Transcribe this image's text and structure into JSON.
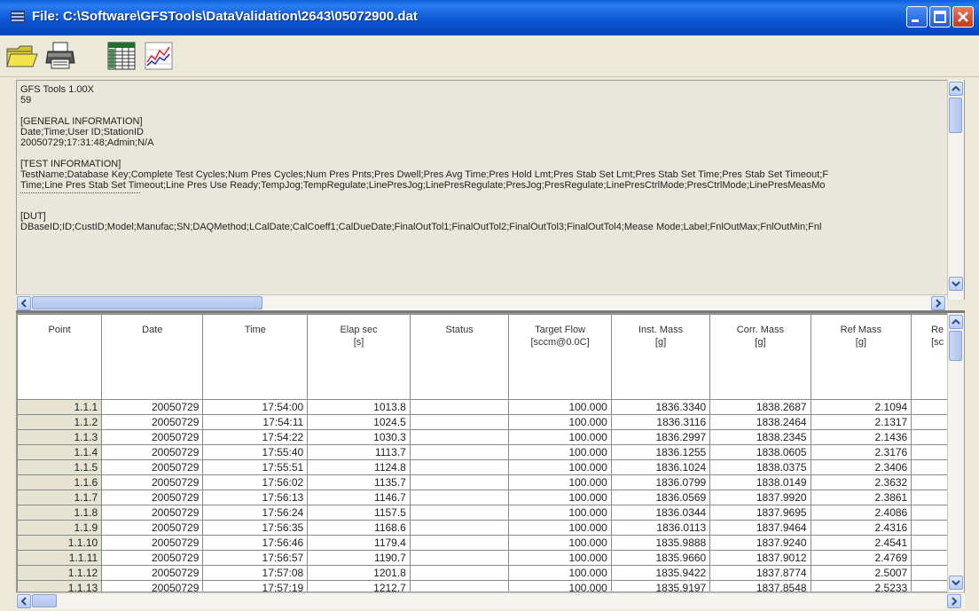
{
  "window": {
    "title": "File: C:\\Software\\GFSTools\\DataValidation\\2643\\05072900.dat"
  },
  "toolbar": {
    "icons": [
      "open-folder-icon",
      "print-icon",
      "table-icon",
      "chart-icon"
    ]
  },
  "info": {
    "line1": "GFS Tools 1.00X",
    "line2": "59",
    "general_header": "[GENERAL INFORMATION]",
    "general_fields": "Date;Time;User ID;StationID",
    "general_values": "20050729;17:31:48;Admin;N/A",
    "test_header": "[TEST INFORMATION]",
    "test_fields_1": "TestName;Database Key;Complete Test Cycles;Num Pres Cycles;Num Pres Pnts;Pres Dwell;Pres Avg Time;Pres Hold Lmt;Pres Stab Set Lmt;Pres Stab Set Time;Pres Stab Set Timeout;F",
    "test_fields_2": "Time;Line Pres Stab Set Timeout;Line Pres Use Ready;TempJog;TempRegulate;LinePresJog;LinePresRegulate;PresJog;PresRegulate;LinePresCtrlMode;PresCtrlMode;LinePresMeasMo",
    "dut_header": "[DUT]",
    "dut_fields": "DBaseID;ID;CustID;Model;Manufac;SN;DAQMethod;LCalDate;CalCoeff1;CalDueDate;FinalOutTol1;FinalOutTol2;FinalOutTol3;FinalOutTol4;Mease Mode;Label;FnlOutMax;FnlOutMin;Fnl"
  },
  "table": {
    "headers": [
      {
        "l1": "Point",
        "l2": ""
      },
      {
        "l1": "Date",
        "l2": ""
      },
      {
        "l1": "Time",
        "l2": ""
      },
      {
        "l1": "Elap sec",
        "l2": "[s]"
      },
      {
        "l1": "Status",
        "l2": ""
      },
      {
        "l1": "Target Flow",
        "l2": "[sccm@0.0C]"
      },
      {
        "l1": "Inst. Mass",
        "l2": "[g]"
      },
      {
        "l1": "Corr. Mass",
        "l2": "[g]"
      },
      {
        "l1": "Ref Mass",
        "l2": "[g]"
      },
      {
        "l1": "Re",
        "l2": "[sc"
      }
    ],
    "rows": [
      [
        "1.1.1",
        "20050729",
        "17:54:00",
        "1013.8",
        "",
        "100.000",
        "1836.3340",
        "1838.2687",
        "2.1094"
      ],
      [
        "1.1.2",
        "20050729",
        "17:54:11",
        "1024.5",
        "",
        "100.000",
        "1836.3116",
        "1838.2464",
        "2.1317"
      ],
      [
        "1.1.3",
        "20050729",
        "17:54:22",
        "1030.3",
        "",
        "100.000",
        "1836.2997",
        "1838.2345",
        "2.1436"
      ],
      [
        "1.1.4",
        "20050729",
        "17:55:40",
        "1113.7",
        "",
        "100.000",
        "1836.1255",
        "1838.0605",
        "2.3176"
      ],
      [
        "1.1.5",
        "20050729",
        "17:55:51",
        "1124.8",
        "",
        "100.000",
        "1836.1024",
        "1838.0375",
        "2.3406"
      ],
      [
        "1.1.6",
        "20050729",
        "17:56:02",
        "1135.7",
        "",
        "100.000",
        "1836.0799",
        "1838.0149",
        "2.3632"
      ],
      [
        "1.1.7",
        "20050729",
        "17:56:13",
        "1146.7",
        "",
        "100.000",
        "1836.0569",
        "1837.9920",
        "2.3861"
      ],
      [
        "1.1.8",
        "20050729",
        "17:56:24",
        "1157.5",
        "",
        "100.000",
        "1836.0344",
        "1837.9695",
        "2.4086"
      ],
      [
        "1.1.9",
        "20050729",
        "17:56:35",
        "1168.6",
        "",
        "100.000",
        "1836.0113",
        "1837.9464",
        "2.4316"
      ],
      [
        "1.1.10",
        "20050729",
        "17:56:46",
        "1179.4",
        "",
        "100.000",
        "1835.9888",
        "1837.9240",
        "2.4541"
      ],
      [
        "1.1.11",
        "20050729",
        "17:56:57",
        "1190.7",
        "",
        "100.000",
        "1835.9660",
        "1837.9012",
        "2.4769"
      ],
      [
        "1.1.12",
        "20050729",
        "17:57:08",
        "1201.8",
        "",
        "100.000",
        "1835.9422",
        "1837.8774",
        "2.5007"
      ],
      [
        "1.1.13",
        "20050729",
        "17:57:19",
        "1212.7",
        "",
        "100.000",
        "1835.9197",
        "1837.8548",
        "2.5233"
      ]
    ]
  }
}
